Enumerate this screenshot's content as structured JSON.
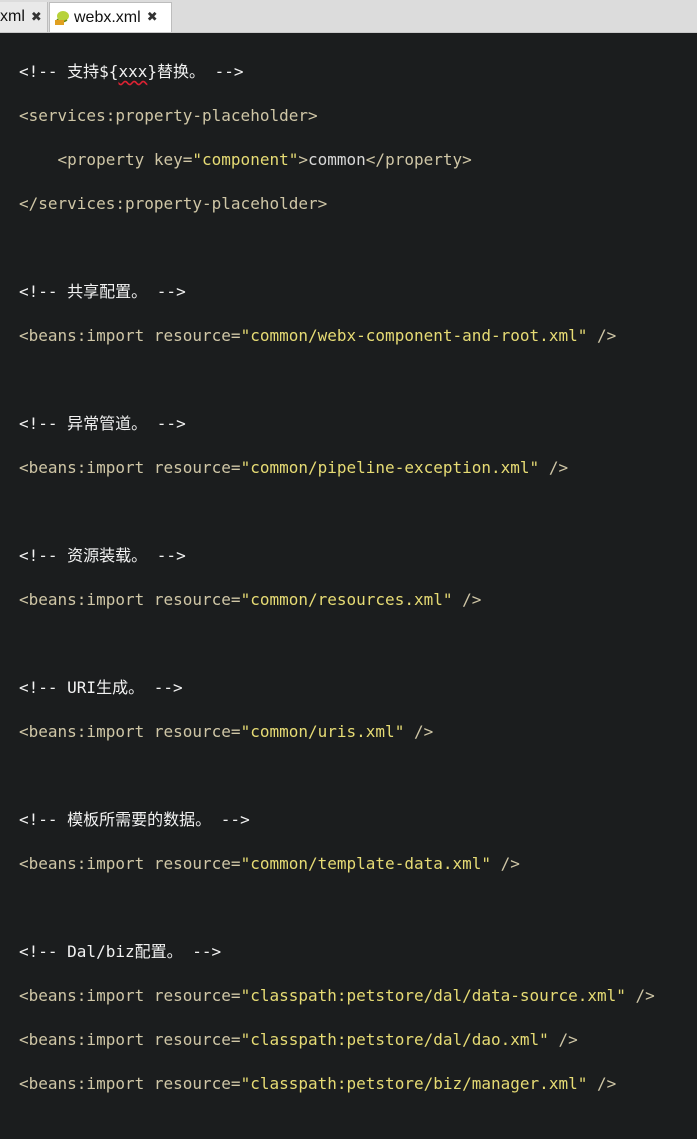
{
  "tabs": [
    {
      "label": "xml",
      "active": false
    },
    {
      "label": "webx.xml",
      "active": true
    }
  ],
  "colors": {
    "background": "#1b1d1e",
    "string": "#e6db74",
    "tag": "#cfc6a6",
    "comment": "#f2f2f2"
  },
  "code": {
    "c1": {
      "open": "<!-- ",
      "pre": "支持${",
      "mark": "xxx",
      "post": "}替换。",
      "close": " -->"
    },
    "pp_open": "<services:property-placeholder>",
    "prop": {
      "indent": "    ",
      "open": "<property key=",
      "key": "\"component\"",
      "gt": ">",
      "value": "common",
      "end": "</property>"
    },
    "pp_close": "</services:property-placeholder>",
    "c2": "<!-- 共享配置。 -->",
    "i2": {
      "pre": "<beans:import resource=",
      "res": "\"common/webx-component-and-root.xml\"",
      "post": " />"
    },
    "c3": "<!-- 异常管道。 -->",
    "i3": {
      "pre": "<beans:import resource=",
      "res": "\"common/pipeline-exception.xml\"",
      "post": " />"
    },
    "c4": "<!-- 资源装载。 -->",
    "i4": {
      "pre": "<beans:import resource=",
      "res": "\"common/resources.xml\"",
      "post": " />"
    },
    "c5": "<!-- URI生成。 -->",
    "i5": {
      "pre": "<beans:import resource=",
      "res": "\"common/uris.xml\"",
      "post": " />"
    },
    "c6": "<!-- 模板所需要的数据。 -->",
    "i6": {
      "pre": "<beans:import resource=",
      "res": "\"common/template-data.xml\"",
      "post": " />"
    },
    "c7": "<!-- Dal/biz配置。 -->",
    "i7a": {
      "pre": "<beans:import resource=",
      "res": "\"classpath:petstore/dal/data-source.xml\"",
      "post": " />"
    },
    "i7b": {
      "pre": "<beans:import resource=",
      "res": "\"classpath:petstore/dal/dao.xml\"",
      "post": " />"
    },
    "i7c": {
      "pre": "<beans:import resource=",
      "res": "\"classpath:petstore/biz/manager.xml\"",
      "post": " />"
    }
  }
}
